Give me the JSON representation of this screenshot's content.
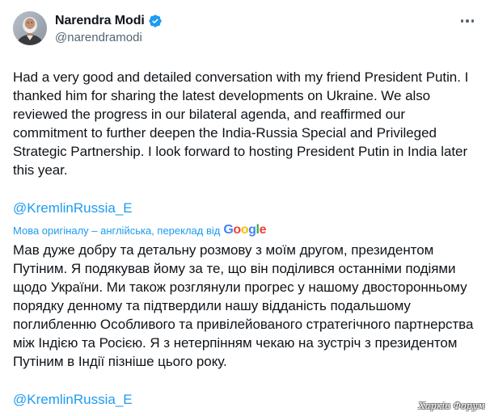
{
  "author": {
    "display_name": "Narendra Modi",
    "handle": "@narendramodi",
    "verified": true,
    "verified_badge_color": "#1d9bf0",
    "avatar_icon": "profile-photo"
  },
  "menu": {
    "icon": "more-horizontal-icon"
  },
  "tweet": {
    "text": "Had a very good and detailed conversation with my friend President Putin. I thanked him for sharing the latest developments on Ukraine. We also reviewed the progress in our bilateral agenda, and reaffirmed our commitment to further deepen the India-Russia Special and Privileged Strategic Partnership. I look forward to hosting President Putin in India later this year.",
    "mention": "@KremlinRussia_E"
  },
  "translation": {
    "label": "Мова оригіналу – англійська, переклад від",
    "provider_letters": [
      "G",
      "o",
      "o",
      "g",
      "l",
      "e"
    ],
    "text": "Мав дуже добру та детальну розмову з моїм другом, президентом Путіним. Я подякував йому за те, що він поділився останніми подіями щодо України. Ми також розглянули прогрес у нашому двосторонньому порядку денному та підтвердили нашу відданість подальшому поглибленню Особливого та привілейованого стратегічного партнерства між Індією та Росією. Я з нетерпінням чекаю на зустріч з президентом Путіним в Індії пізніше цього року.",
    "mention": "@KremlinRussia_E"
  },
  "colors": {
    "text_primary": "#0f1419",
    "text_secondary": "#536471",
    "link": "#1d9bf0",
    "background": "#ffffff"
  },
  "watermark": {
    "text": "Харків Форум"
  }
}
